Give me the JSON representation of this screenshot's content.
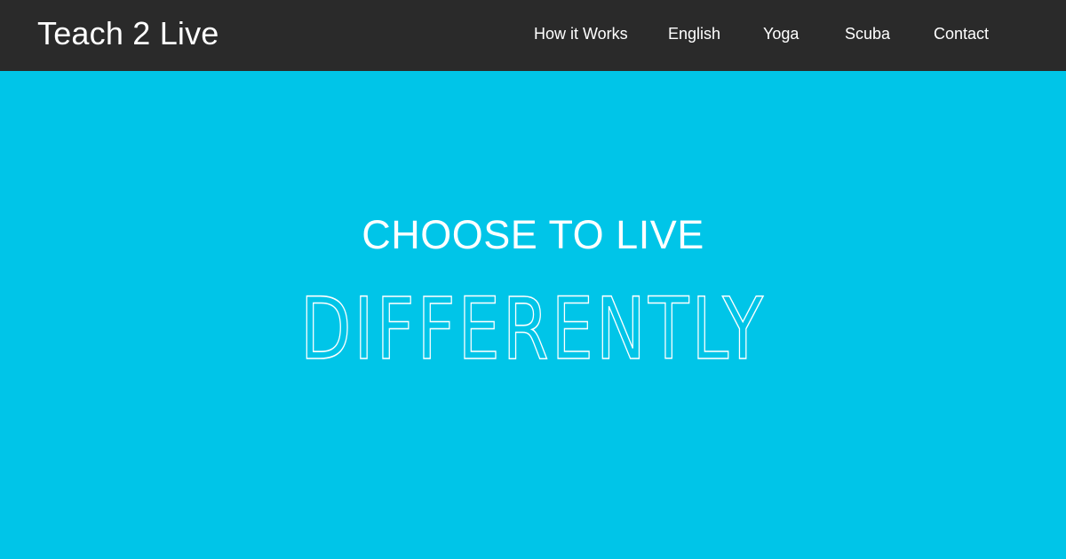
{
  "navbar": {
    "brand": "Teach 2 Live",
    "links": [
      {
        "label": "How it Works"
      },
      {
        "label": "English"
      },
      {
        "label": "Yoga"
      },
      {
        "label": "Scuba"
      },
      {
        "label": "Contact"
      }
    ]
  },
  "hero": {
    "tagline": "CHOOSE TO LIVE",
    "headline": "DIFFERENTLY"
  },
  "colors": {
    "hero_background": "#00c5e8",
    "navbar_background": "#2a2a2a",
    "text": "#ffffff"
  }
}
